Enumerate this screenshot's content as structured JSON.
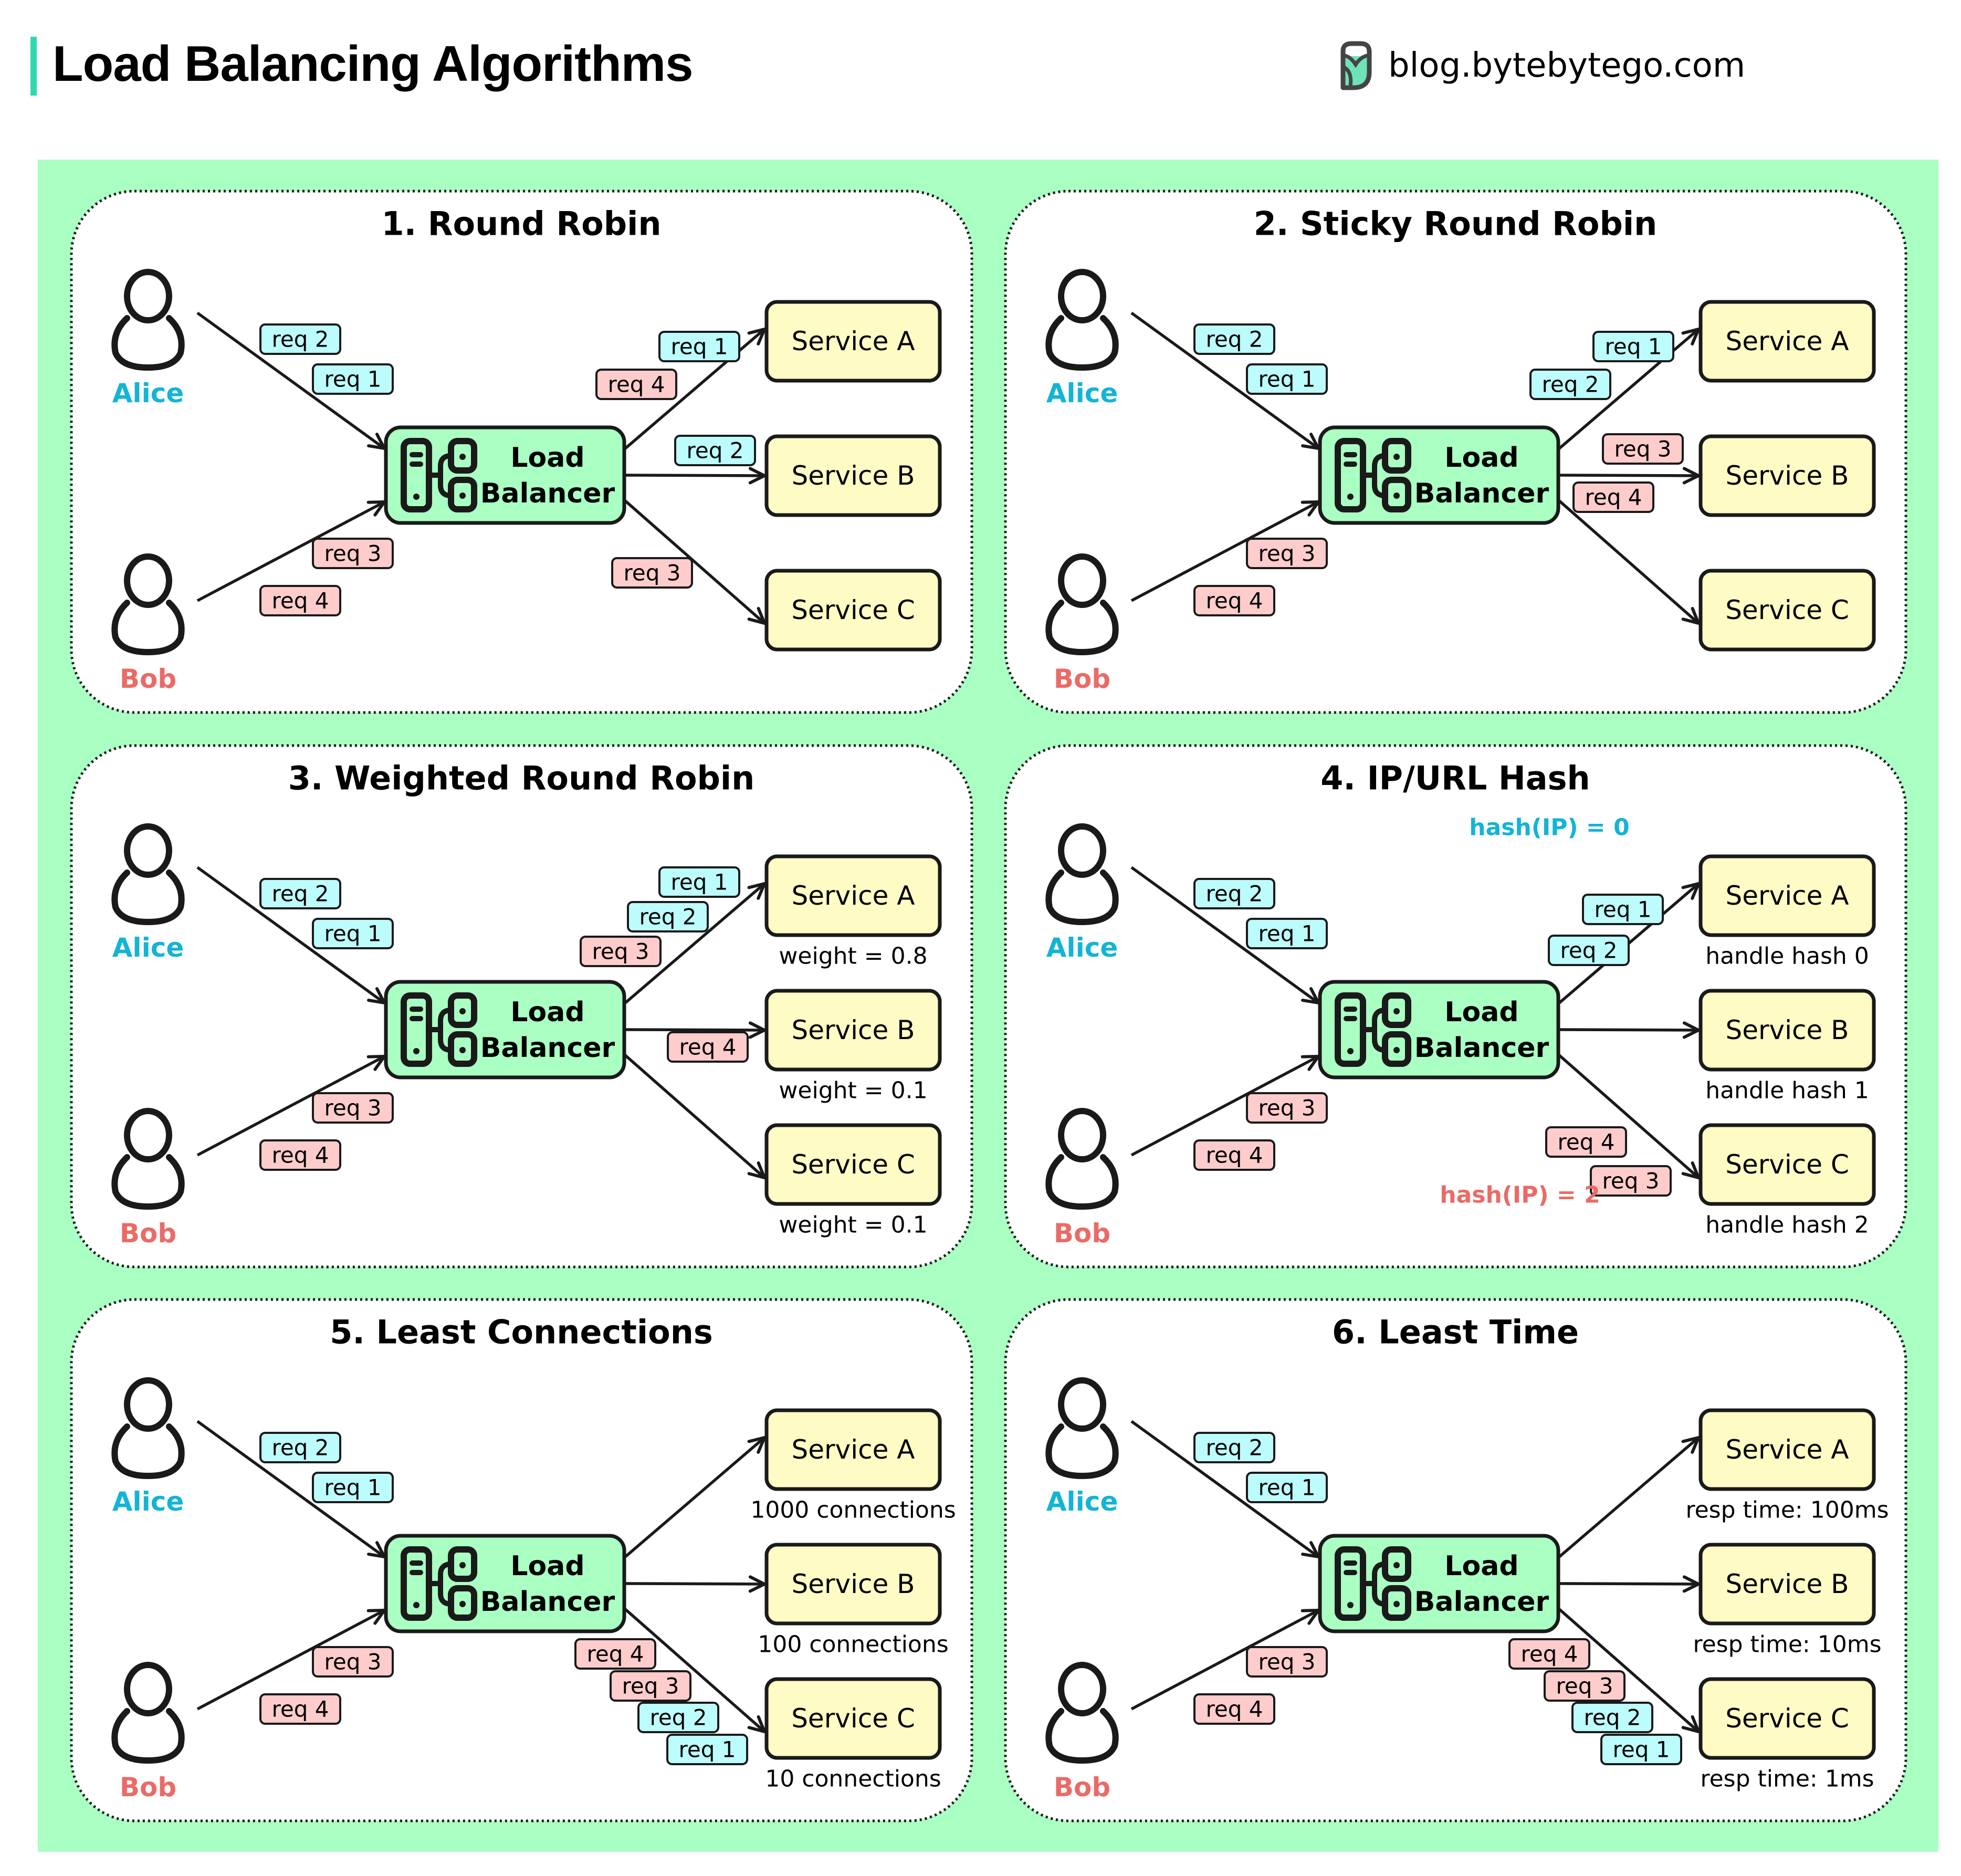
{
  "header": {
    "title": "Load Balancing Algorithms",
    "brand": "blog.bytebytego.com",
    "brand_icon": "bytebytego-logo-icon"
  },
  "colors": {
    "accent_bar": "#2fd8b0",
    "canvas_bg": "#aaffc3",
    "panel_bg": "#ffffff",
    "load_balancer_fill": "#aaffc3",
    "service_fill": "#fffbc4",
    "alice": "#13b4d6",
    "bob": "#ea6b66",
    "tag_alice_fill": "#bdfcfd",
    "tag_bob_fill": "#ffcccc",
    "stroke": "#1a1a1a"
  },
  "common": {
    "client_alice": "Alice",
    "client_bob": "Bob",
    "load_balancer_line1": "Load",
    "load_balancer_line2": "Balancer",
    "services": [
      "Service A",
      "Service B",
      "Service C"
    ]
  },
  "panels": [
    {
      "title": "1. Round Robin",
      "incoming": {
        "alice": [
          "req 2",
          "req 1"
        ],
        "bob": [
          "req 3",
          "req 4"
        ]
      },
      "outgoing": {
        "a": [
          {
            "label": "req 1",
            "from": "alice"
          },
          {
            "label": "req 4",
            "from": "bob"
          }
        ],
        "b": [
          {
            "label": "req 2",
            "from": "alice"
          }
        ],
        "c": [
          {
            "label": "req 3",
            "from": "bob"
          }
        ]
      },
      "service_notes": [
        "",
        "",
        ""
      ],
      "hash_labels": []
    },
    {
      "title": "2. Sticky Round Robin",
      "incoming": {
        "alice": [
          "req 2",
          "req 1"
        ],
        "bob": [
          "req 3",
          "req 4"
        ]
      },
      "outgoing": {
        "a": [
          {
            "label": "req 1",
            "from": "alice"
          },
          {
            "label": "req 2",
            "from": "alice"
          }
        ],
        "b": [
          {
            "label": "req 3",
            "from": "bob"
          },
          {
            "label": "req 4",
            "from": "bob"
          }
        ],
        "c": []
      },
      "service_notes": [
        "",
        "",
        ""
      ],
      "hash_labels": []
    },
    {
      "title": "3. Weighted Round Robin",
      "incoming": {
        "alice": [
          "req 2",
          "req 1"
        ],
        "bob": [
          "req 3",
          "req 4"
        ]
      },
      "outgoing": {
        "a": [
          {
            "label": "req 1",
            "from": "alice"
          },
          {
            "label": "req 2",
            "from": "alice"
          },
          {
            "label": "req 3",
            "from": "bob"
          }
        ],
        "b": [
          {
            "label": "req 4",
            "from": "bob"
          }
        ],
        "c": []
      },
      "service_notes": [
        "weight = 0.8",
        "weight = 0.1",
        "weight = 0.1"
      ],
      "hash_labels": []
    },
    {
      "title": "4. IP/URL Hash",
      "incoming": {
        "alice": [
          "req 2",
          "req 1"
        ],
        "bob": [
          "req 3",
          "req 4"
        ]
      },
      "outgoing": {
        "a": [
          {
            "label": "req 1",
            "from": "alice"
          },
          {
            "label": "req 2",
            "from": "alice"
          }
        ],
        "b": [],
        "c": [
          {
            "label": "req 4",
            "from": "bob"
          },
          {
            "label": "req 3",
            "from": "bob"
          }
        ]
      },
      "service_notes": [
        "handle hash 0",
        "handle hash 1",
        "handle hash 2"
      ],
      "hash_labels": [
        {
          "text": "hash(IP) = 0",
          "from": "alice"
        },
        {
          "text": "hash(IP) = 2",
          "from": "bob"
        }
      ]
    },
    {
      "title": "5. Least Connections",
      "incoming": {
        "alice": [
          "req 2",
          "req 1"
        ],
        "bob": [
          "req 3",
          "req 4"
        ]
      },
      "outgoing": {
        "a": [],
        "b": [],
        "c": [
          {
            "label": "req 4",
            "from": "bob"
          },
          {
            "label": "req 3",
            "from": "bob"
          },
          {
            "label": "req 2",
            "from": "alice"
          },
          {
            "label": "req 1",
            "from": "alice"
          }
        ]
      },
      "service_notes": [
        "1000 connections",
        "100 connections",
        "10 connections"
      ],
      "hash_labels": []
    },
    {
      "title": "6. Least Time",
      "incoming": {
        "alice": [
          "req 2",
          "req 1"
        ],
        "bob": [
          "req 3",
          "req 4"
        ]
      },
      "outgoing": {
        "a": [],
        "b": [],
        "c": [
          {
            "label": "req 4",
            "from": "bob"
          },
          {
            "label": "req 3",
            "from": "bob"
          },
          {
            "label": "req 2",
            "from": "alice"
          },
          {
            "label": "req 1",
            "from": "alice"
          }
        ]
      },
      "service_notes": [
        "resp time: 100ms",
        "resp time: 10ms",
        "resp time: 1ms"
      ],
      "hash_labels": []
    }
  ]
}
